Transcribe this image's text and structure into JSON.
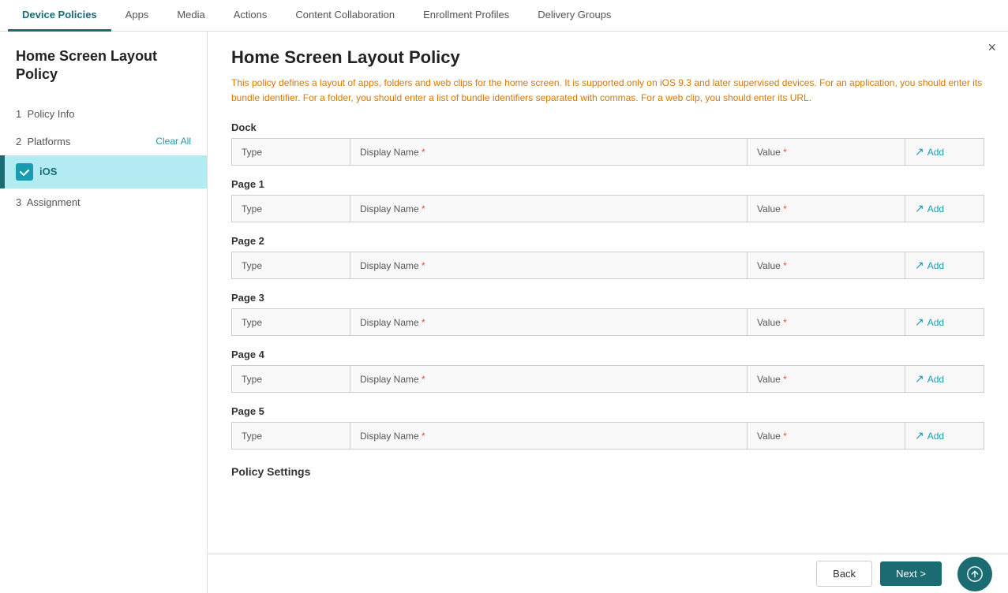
{
  "nav": {
    "tabs": [
      {
        "id": "device-policies",
        "label": "Device Policies",
        "active": true
      },
      {
        "id": "apps",
        "label": "Apps",
        "active": false
      },
      {
        "id": "media",
        "label": "Media",
        "active": false
      },
      {
        "id": "actions",
        "label": "Actions",
        "active": false
      },
      {
        "id": "content-collaboration",
        "label": "Content Collaboration",
        "active": false
      },
      {
        "id": "enrollment-profiles",
        "label": "Enrollment Profiles",
        "active": false
      },
      {
        "id": "delivery-groups",
        "label": "Delivery Groups",
        "active": false
      }
    ]
  },
  "sidebar": {
    "title": "Home Screen Layout Policy",
    "steps": [
      {
        "id": "policy-info",
        "number": "1",
        "label": "Policy Info",
        "active": false,
        "has_indicator": false
      },
      {
        "id": "platforms",
        "number": "2",
        "label": "Platforms",
        "active": false,
        "has_indicator": false
      },
      {
        "id": "assignment",
        "number": "3",
        "label": "Assignment",
        "active": false,
        "has_indicator": false
      }
    ],
    "clear_all": "Clear All",
    "ios_label": "iOS"
  },
  "main": {
    "title": "Home Screen Layout Policy",
    "close_btn": "×",
    "description": "This policy defines a layout of apps, folders and web clips for the home screen. It is supported only on iOS 9.3 and later supervised devices. For an application, you should enter its bundle identifier. For a folder, you should enter a list of bundle identifiers separated with commas. For a web clip, you should enter its URL.",
    "sections": [
      {
        "id": "dock",
        "label": "Dock"
      },
      {
        "id": "page1",
        "label": "Page 1"
      },
      {
        "id": "page2",
        "label": "Page 2"
      },
      {
        "id": "page3",
        "label": "Page 3"
      },
      {
        "id": "page4",
        "label": "Page 4"
      },
      {
        "id": "page5",
        "label": "Page 5"
      }
    ],
    "table_headers": {
      "type": "Type",
      "display_name": "Display Name",
      "required_star": "*",
      "value": "Value",
      "add": "Add"
    },
    "policy_settings_label": "Policy Settings",
    "add_label": "Add"
  },
  "footer": {
    "back_label": "Back",
    "next_label": "Next >"
  }
}
